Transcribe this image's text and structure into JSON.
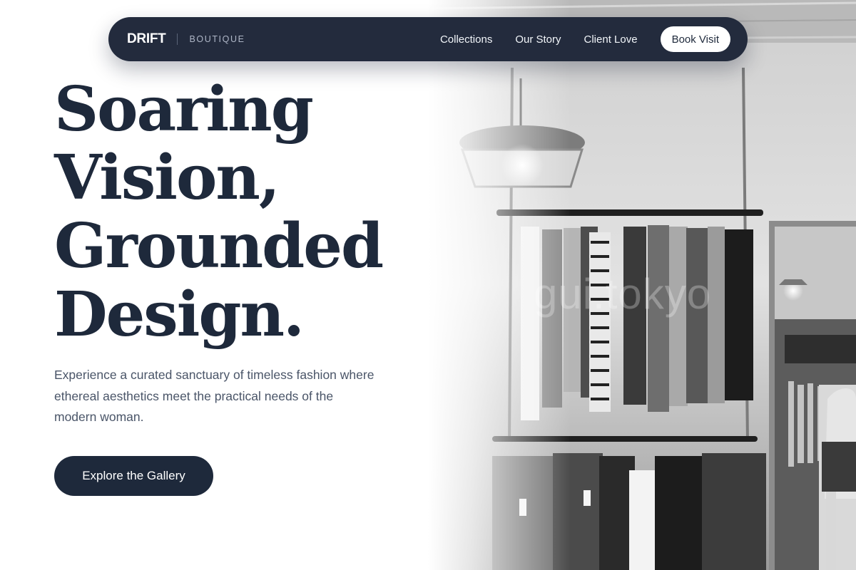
{
  "nav": {
    "brand": "DRIFT",
    "brand_sub": "BOUTIQUE",
    "links": [
      {
        "label": "Collections"
      },
      {
        "label": "Our Story"
      },
      {
        "label": "Client Love"
      }
    ],
    "cta": "Book Visit"
  },
  "hero": {
    "headline": [
      "Soaring",
      "Vision,",
      "Grounded",
      "Design."
    ],
    "subtext": "Experience a curated sanctuary of timeless fashion where ethereal aesthetics meet the practical needs of the modern woman.",
    "cta": "Explore the Gallery",
    "image_watermark": "gui.tokyo"
  },
  "colors": {
    "navy": "#1e293b",
    "nav_bg": "#232b3d",
    "body_text": "#4a5568",
    "background": "#ffffff"
  }
}
